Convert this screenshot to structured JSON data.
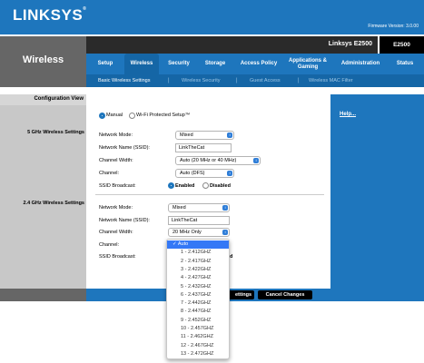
{
  "header": {
    "brand": "LINKSYS",
    "firmware": "Firmware Version: 3.0.00"
  },
  "product": {
    "name": "Linksys E2500",
    "model": "E2500"
  },
  "section_title": "Wireless",
  "tabs": [
    {
      "label": "Setup"
    },
    {
      "label": "Wireless",
      "active": true
    },
    {
      "label": "Security"
    },
    {
      "label": "Storage"
    },
    {
      "label": "Access Policy"
    },
    {
      "label": "Applications & Gaming"
    },
    {
      "label": "Administration"
    },
    {
      "label": "Status"
    }
  ],
  "subtabs": [
    {
      "label": "Basic Wireless Settings",
      "active": true
    },
    {
      "label": "Wireless Security"
    },
    {
      "label": "Guest Access"
    },
    {
      "label": "Wireless MAC Filter"
    }
  ],
  "separator": "|",
  "left": {
    "config_view": "Configuration View",
    "section_5g": "5 GHz Wireless Settings",
    "section_24g": "2.4 GHz Wireless Settings"
  },
  "help_link": "Help...",
  "config_mode": {
    "manual": "Manual",
    "wps": "Wi-Fi Protected Setup™",
    "selected": "manual"
  },
  "band5": {
    "network_mode_label": "Network Mode:",
    "network_mode": "Mixed",
    "ssid_label": "Network Name (SSID):",
    "ssid": "LinkTheCat",
    "channel_width_label": "Channel Width:",
    "channel_width": "Auto (20 MHz or 40 MHz)",
    "channel_label": "Channel:",
    "channel": "Auto (DFS)",
    "broadcast_label": "SSID Broadcast:",
    "enabled": "Enabled",
    "disabled": "Disabled",
    "broadcast": "enabled"
  },
  "band24": {
    "network_mode_label": "Network Mode:",
    "network_mode": "Mixed",
    "ssid_label": "Network Name (SSID):",
    "ssid": "LinkTheCat",
    "channel_width_label": "Channel Width:",
    "channel_width": "20 MHz Only",
    "channel_label": "Channel:",
    "broadcast_label": "SSID Broadcast:",
    "disabled_fragment": "d"
  },
  "channel_dropdown": {
    "selected_mark": "✓",
    "options": [
      "Auto",
      "1 - 2.412GHZ",
      "2 - 2.417GHZ",
      "3 - 2.422GHZ",
      "4 - 2.427GHZ",
      "5 - 2.432GHZ",
      "6 - 2.437GHZ",
      "7 - 2.442GHZ",
      "8 - 2.447GHZ",
      "9 - 2.452GHZ",
      "10 - 2.457GHZ",
      "11 - 2.462GHZ",
      "12 - 2.467GHZ",
      "13 - 2.472GHZ"
    ]
  },
  "footer": {
    "save_partial": "ettings",
    "cancel": "Cancel Changes"
  },
  "colors": {
    "brand_blue": "#1e76bd",
    "subnav_blue": "#1566a6",
    "highlight": "#3478f6",
    "gray": "#666666"
  }
}
